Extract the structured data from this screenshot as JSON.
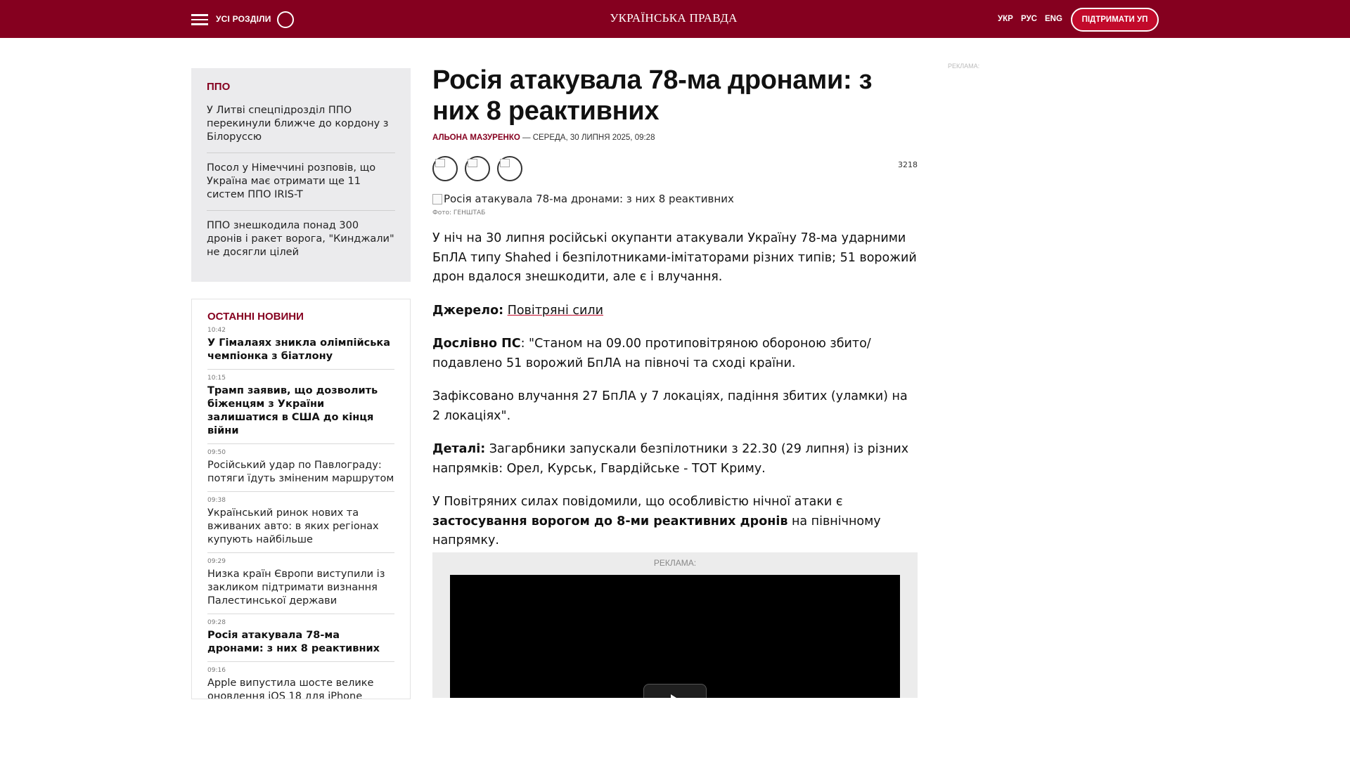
{
  "header": {
    "sections_label": "УСІ РОЗДІЛИ",
    "logo": "УКРАЇНСЬКА ПРАВДА",
    "languages": [
      "УКР",
      "РУС",
      "ENG"
    ],
    "support_button": "ПІДТРИМАТИ УП",
    "brand_color": "#85001f"
  },
  "sidebar": {
    "ppo": {
      "title": "ППО",
      "items": [
        "У Литві спецпідрозділ ППО перекинули ближче до кордону з Білоруссю",
        "Посол у Німеччині розповів, що Україна має отримати ще 11 систем ППО IRIS-T",
        "ППО знешкодила понад 300 дронів і ракет ворога, \"Кинджали\" не досягли цілей"
      ]
    },
    "latest": {
      "title": "ОСТАННІ НОВИНИ",
      "items": [
        {
          "time": "10:42",
          "text": "У Гімалаях зникла олімпійська чемпіонка з біатлону"
        },
        {
          "time": "10:15",
          "text": "Трамп заявив, що дозволить біженцям з України залишатися в США до кінця війни"
        },
        {
          "time": "09:50",
          "text": "Російський удар по Павлограду: потяги їдуть зміненим маршрутом"
        },
        {
          "time": "09:38",
          "text": "Український ринок нових та вживаних авто: в яких регіонах купують найбільше"
        },
        {
          "time": "09:29",
          "text": "Низка країн Європи виступили із закликом підтримати визнання Палестинської держави"
        },
        {
          "time": "09:28",
          "text": "Росія атакувала 78-ма дронами: з них 8 реактивних"
        },
        {
          "time": "09:16",
          "text": "Apple випустила шосте велике оновлення iOS 18 для iPhone"
        }
      ]
    }
  },
  "article": {
    "headline": "Росія атакувала 78-ма дронами: з них 8 реактивних",
    "author": "АЛЬОНА МАЗУРЕНКО",
    "byline_sep": " — ",
    "date": "СЕРЕДА, 30 ЛИПНЯ 2025, 09:28",
    "views": "3218",
    "photo_alt": "Росія атакувала 78-ма дронами: з них 8 реактивних",
    "photo_caption": "Фото: ГЕНШТАБ",
    "p1": "У ніч на 30 липня російські окупанти атакували Україну 78-ма ударними БпЛА типу Shahed і безпілотниками-імітаторами різних типів; 51 ворожий дрон вдалося знешкодити, але є і влучання.",
    "source_label": "Джерело:",
    "source_link": "Повітряні сили",
    "quote_label": "Дослівно ПС",
    "quote_text": ": \"Станом на 09.00 протиповітряною обороною збито/подавлено 51 ворожий БпЛА на півночі та сході країни.",
    "p_hits": "Зафіксовано влучання 27 БпЛА у 7 локаціях, падіння збитих (уламки) на 2 локаціях\".",
    "details_label": "Деталі:",
    "details_text": " Загарбники запускали безпілотники з 22.30 (29 липня) із різних напрямків: Орел, Курськ, Гвардійське - ТОТ Криму.",
    "p_last_start": "У Повітряних силах повідомили, що особливістю нічної атаки є ",
    "p_last_bold": "застосування ворогом до 8-ми реактивних дронів",
    "p_last_end": " на північному напрямку.",
    "ad_label": "РЕКЛАМА:"
  },
  "right_ad_label": "РЕКЛАМА:"
}
